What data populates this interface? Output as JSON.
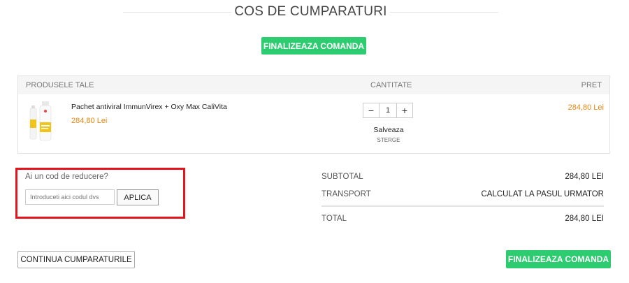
{
  "page": {
    "title": "COS DE CUMPARATURI",
    "checkout_top_label": "FINALIZEAZA COMANDA",
    "checkout_bottom_label": "FINALIZEAZA COMANDA",
    "continue_label": "CONTINUA CUMPARATURILE"
  },
  "cart": {
    "headers": {
      "products": "PRODUSELE TALE",
      "quantity": "CANTITATE",
      "price": "PRET"
    },
    "items": [
      {
        "name": "Pachet antiviral ImmunVirex + Oxy Max CaliVita",
        "unit_price": "284,80 Lei",
        "quantity": "1",
        "save_label": "Salveaza",
        "delete_label": "STERGE",
        "line_price": "284,80 Lei"
      }
    ],
    "qty_minus": "−",
    "qty_plus": "+"
  },
  "coupon": {
    "label": "Ai un cod de reducere?",
    "placeholder": "Introduceti aici codul dvs",
    "apply_label": "APLICA"
  },
  "totals": {
    "subtotal_label": "SUBTOTAL",
    "subtotal_value": "284,80 LEI",
    "transport_label": "TRANSPORT",
    "transport_value": "CALCULAT LA PASUL URMATOR",
    "total_label": "TOTAL",
    "total_value": "284,80 LEI"
  },
  "colors": {
    "accent_green": "#2ecc71",
    "price_orange": "#e8860f",
    "highlight_red": "#e3141c"
  }
}
